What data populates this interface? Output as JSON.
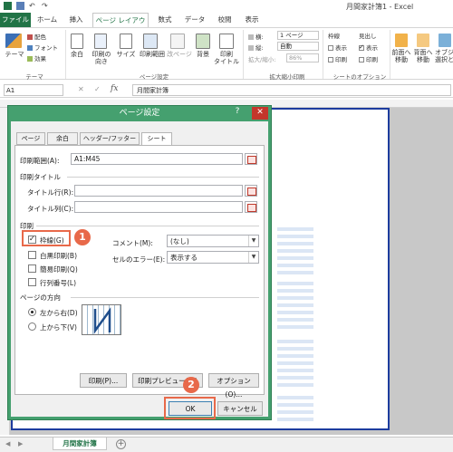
{
  "window": {
    "title": "月間家計簿1 - Excel"
  },
  "ribbon_tabs": [
    "ファイル",
    "ホーム",
    "挿入",
    "ページ レイアウト",
    "数式",
    "データ",
    "校閲",
    "表示"
  ],
  "ribbon": {
    "theme": {
      "label": "テーマ",
      "colors": "配色",
      "fonts": "フォント",
      "effects": "効果",
      "group": "テーマ"
    },
    "page_setup": {
      "margins": "余白",
      "orientation": "印刷の\n向き",
      "size": "サイズ",
      "print_area": "印刷範囲",
      "breaks": "改ページ",
      "background": "背景",
      "print_titles": "印刷\nタイトル",
      "group": "ページ設定"
    },
    "scale": {
      "width_label": "横:",
      "width_value": "1 ページ",
      "height_label": "縦:",
      "height_value": "自動",
      "scale_label": "拡大/縮小:",
      "scale_value": "86%",
      "group": "拡大縮小印刷"
    },
    "sheet_options": {
      "gridlines": "枠線",
      "headings": "見出し",
      "view": "表示",
      "print": "印刷",
      "group": "シートのオプション"
    },
    "arrange": {
      "forward": "前面へ\n移動",
      "backward": "背面へ\n移動",
      "selection": "オブジェクトの\n選択と表示"
    }
  },
  "formula_bar": {
    "name_box": "A1",
    "fx": "fx",
    "content": "月間家計簿"
  },
  "sheet_tab": "月間家計簿",
  "dialog": {
    "title": "ページ設定",
    "help": "?",
    "close": "✕",
    "tabs": [
      "ページ",
      "余白",
      "ヘッダー/フッター",
      "シート"
    ],
    "print_area_label": "印刷範囲(A):",
    "print_area_value": "A1:M45",
    "print_titles_heading": "印刷タイトル",
    "title_rows_label": "タイトル行(R):",
    "title_cols_label": "タイトル列(C):",
    "print_heading": "印刷",
    "gridlines_label": "枠線(G)",
    "bw_label": "白黒印刷(B)",
    "draft_label": "簡易印刷(Q)",
    "rowcol_label": "行列番号(L)",
    "comments_label": "コメント(M):",
    "comments_value": "(なし)",
    "errors_label": "セルのエラー(E):",
    "errors_value": "表示する",
    "order_heading": "ページの方向",
    "down_then_over": "左から右(D)",
    "over_then_down": "上から下(V)",
    "print_button": "印刷(P)...",
    "preview_button": "印刷プレビュー(W)",
    "options_button": "オプション(O)...",
    "ok_button": "OK",
    "cancel_button": "キャンセル"
  },
  "annotations": {
    "step1": "1",
    "step2": "2"
  },
  "colors": {
    "excel_green": "#217346",
    "accent": "#e8694a",
    "dialog_green": "#45a06f"
  }
}
